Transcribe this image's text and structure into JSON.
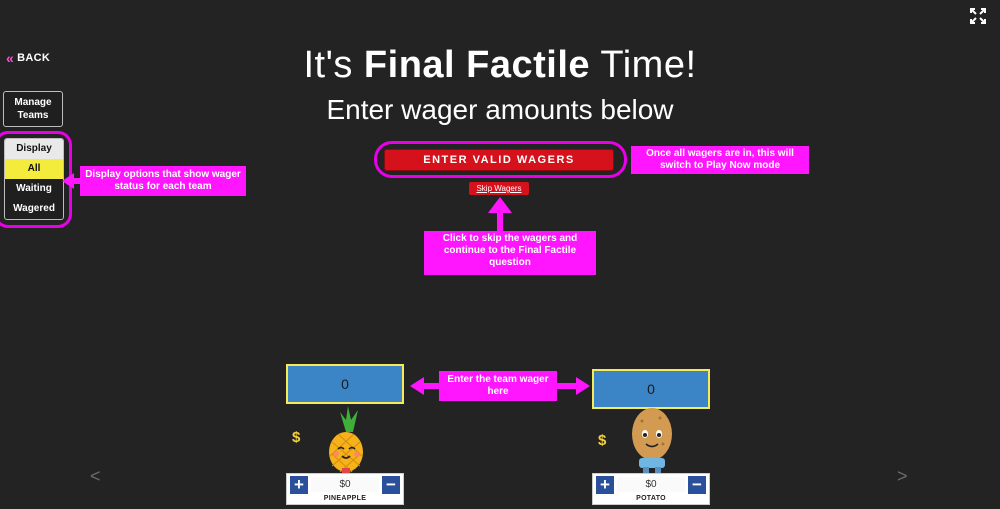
{
  "nav": {
    "back_label": "BACK"
  },
  "sidebar": {
    "manage_teams_label": "Manage Teams",
    "display": {
      "header": "Display",
      "options": [
        "All",
        "Waiting",
        "Wagered"
      ],
      "selected": "All"
    }
  },
  "header": {
    "title_pre": "It's ",
    "title_bold": "Final Factile",
    "title_post": " Time!",
    "subtitle": "Enter wager amounts below"
  },
  "actions": {
    "enter_label": "ENTER VALID WAGERS",
    "skip_label": "Skip Wagers"
  },
  "annotations": {
    "display": "Display options that show wager status for each team",
    "play_now": "Once all wagers are in, this will switch to Play Now mode",
    "skip": "Click to skip the wagers and continue to the Final Factile question",
    "wager": "Enter the team wager here"
  },
  "teams": [
    {
      "name": "PINEAPPLE",
      "wager": "0",
      "currency": "$",
      "amount": "$0"
    },
    {
      "name": "POTATO",
      "wager": "0",
      "currency": "$",
      "amount": "$0"
    }
  ],
  "stepper": {
    "plus": "+",
    "minus": "−"
  },
  "carousel": {
    "prev": "<",
    "next": ">"
  },
  "colors": {
    "background": "#232323",
    "highlight": "#e800e8",
    "annotation": "#ff16ff",
    "primary_button": "#d5111c",
    "selected_option": "#f3ec3c",
    "wager_field": "#3b85c6",
    "wager_border": "#f5e95c",
    "stepper": "#2a4f9b",
    "back_chevron": "#ff4fd8"
  },
  "icons": {
    "fullscreen": "expand-icon",
    "back": "double-chevron-left-icon"
  }
}
